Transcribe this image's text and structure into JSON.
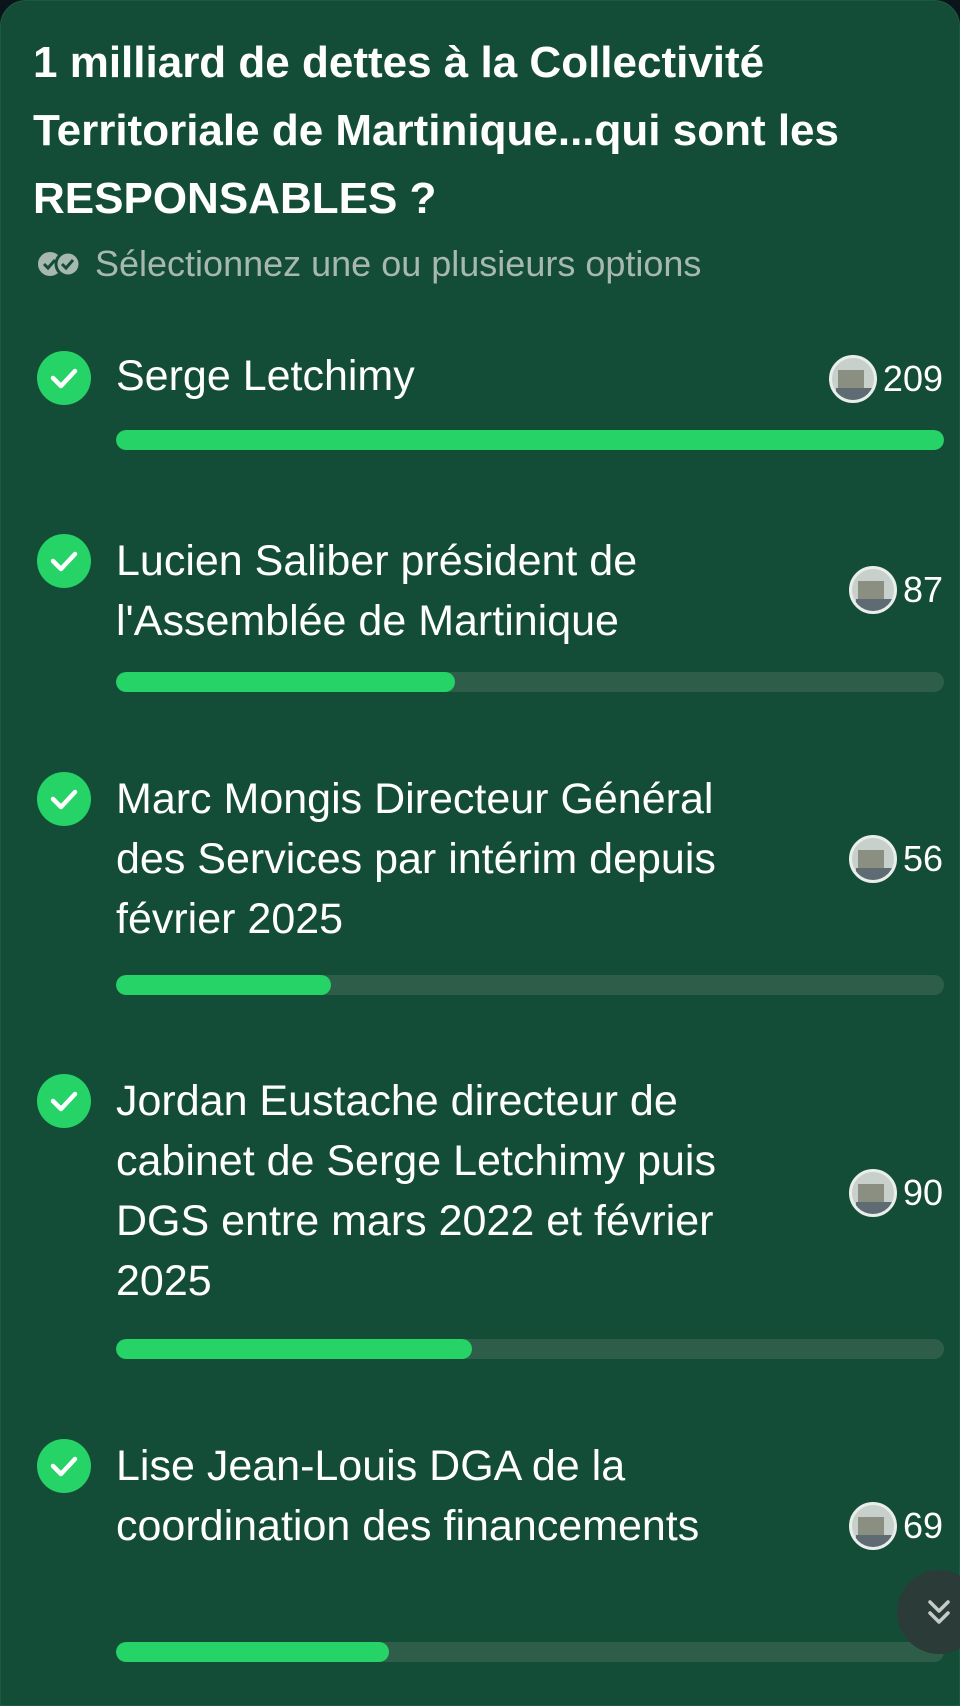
{
  "poll": {
    "title": "1 milliard de dettes à la Collectivité Territoriale de Martinique...qui sont les RESPONSABLES ?",
    "subtitle": "Sélectionnez une ou plusieurs options",
    "options": [
      {
        "label": "Serge Letchimy",
        "votes": "209",
        "progress": 1.0
      },
      {
        "label": "Lucien Saliber président de l'Assemblée de Martinique",
        "votes": "87",
        "progress": 0.41
      },
      {
        "label": "Marc Mongis Directeur Général des Services par intérim depuis février 2025",
        "votes": "56",
        "progress": 0.26
      },
      {
        "label": "Jordan Eustache directeur de cabinet de Serge Letchimy puis DGS entre mars 2022 et février 2025",
        "votes": "90",
        "progress": 0.43
      },
      {
        "label": "Lise Jean-Louis DGA de la coordination des financements",
        "votes": "69",
        "progress": 0.33
      }
    ]
  },
  "colors": {
    "bubble": "#144d37",
    "accent": "#25d366",
    "track": "#2e5e4a",
    "muted_text": "#a7b8b0"
  },
  "icons": [
    "check-circle-icon",
    "multi-select-icon",
    "avatar",
    "double-chevron-down-icon"
  ]
}
